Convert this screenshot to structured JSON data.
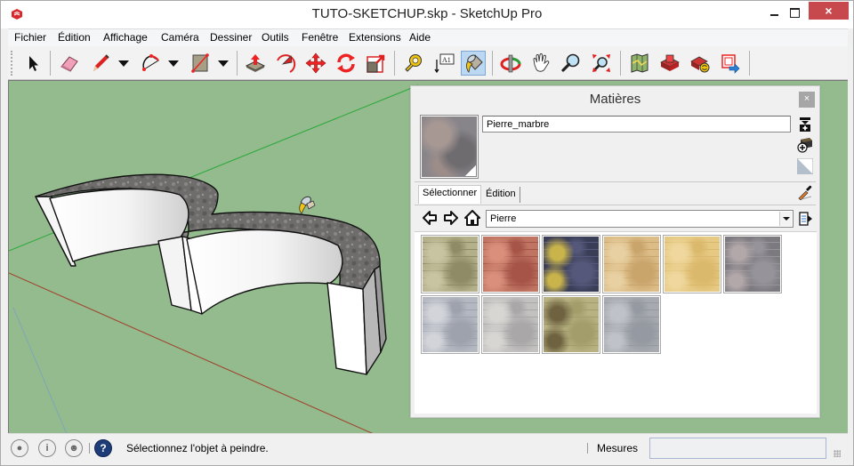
{
  "window": {
    "title": "TUTO-SKETCHUP.skp - SketchUp Pro",
    "close_label": "×"
  },
  "menu": {
    "items": [
      "Fichier",
      "Édition",
      "Affichage",
      "Caméra",
      "Dessiner",
      "Outils",
      "Fenêtre",
      "Extensions",
      "Aide"
    ]
  },
  "toolbar": {
    "tools": [
      {
        "name": "select",
        "icon": "arrow-cursor-icon"
      },
      {
        "name": "eraser",
        "icon": "eraser-icon"
      },
      {
        "name": "pencil",
        "icon": "pencil-icon",
        "dropdown": true
      },
      {
        "name": "arc",
        "icon": "arc-icon",
        "dropdown": true
      },
      {
        "name": "rectangle",
        "icon": "rectangle-icon",
        "dropdown": true
      },
      {
        "name": "push-pull",
        "icon": "push-pull-icon"
      },
      {
        "name": "follow-me",
        "icon": "follow-me-icon"
      },
      {
        "name": "move",
        "icon": "move-icon"
      },
      {
        "name": "rotate",
        "icon": "rotate-icon"
      },
      {
        "name": "scale",
        "icon": "scale-icon"
      },
      {
        "name": "tape-measure",
        "icon": "tape-measure-icon"
      },
      {
        "name": "text",
        "icon": "text-label-icon",
        "text": "A1"
      },
      {
        "name": "paint-bucket",
        "icon": "paint-bucket-icon",
        "active": true
      },
      {
        "name": "orbit",
        "icon": "orbit-icon"
      },
      {
        "name": "pan",
        "icon": "hand-icon"
      },
      {
        "name": "zoom",
        "icon": "magnifier-icon"
      },
      {
        "name": "zoom-extents",
        "icon": "zoom-extents-icon"
      },
      {
        "name": "add-location",
        "icon": "map-icon"
      },
      {
        "name": "3d-warehouse",
        "icon": "warehouse-icon"
      },
      {
        "name": "share-model",
        "icon": "share-model-icon"
      },
      {
        "name": "extension-warehouse",
        "icon": "extension-warehouse-icon"
      }
    ]
  },
  "materials_panel": {
    "title": "Matières",
    "close_label": "×",
    "material_name": "Pierre_marbre",
    "tabs": [
      {
        "label": "Sélectionner",
        "selected": true
      },
      {
        "label": "Édition",
        "selected": false
      }
    ],
    "collection": "Pierre",
    "swatches": [
      {
        "name": "stone-ledge",
        "colors": [
          "#b4b08a",
          "#8f8b66",
          "#c8c3a1"
        ]
      },
      {
        "name": "stone-red-brick",
        "colors": [
          "#c07563",
          "#a65448",
          "#d98f7c"
        ]
      },
      {
        "name": "stone-granite-dark",
        "colors": [
          "#3a3d56",
          "#55587a",
          "#c9b44c"
        ]
      },
      {
        "name": "stone-sandstone-blocks",
        "colors": [
          "#dcbd87",
          "#c9a46b",
          "#e8d0a2"
        ]
      },
      {
        "name": "stone-sand-yellow",
        "colors": [
          "#e6c983",
          "#dbb96c",
          "#efd79d"
        ]
      },
      {
        "name": "stone-marble-grey",
        "colors": [
          "#7c7a7f",
          "#96949a",
          "#b2a7a9"
        ]
      },
      {
        "name": "stone-marble-blue-grey",
        "colors": [
          "#b4b8c1",
          "#9ea2ad",
          "#d2d4da"
        ]
      },
      {
        "name": "stone-tiles-grey",
        "colors": [
          "#c3c1c0",
          "#a9a7a8",
          "#d8d6d2"
        ]
      },
      {
        "name": "stone-flagstone-green",
        "colors": [
          "#b8b283",
          "#a29d6a",
          "#6e6240"
        ]
      },
      {
        "name": "stone-slate-grey",
        "colors": [
          "#a7aab0",
          "#959aa2",
          "#bfc2c8"
        ]
      }
    ]
  },
  "status_bar": {
    "message": "Sélectionnez l'objet à peindre.",
    "help_label": "?",
    "measurements_label": "Mesures",
    "measurements_value": ""
  },
  "colors": {
    "viewport_bg": "#94bb8e",
    "accent_close": "#c7494d",
    "active_tool": "#bcd7f1"
  }
}
